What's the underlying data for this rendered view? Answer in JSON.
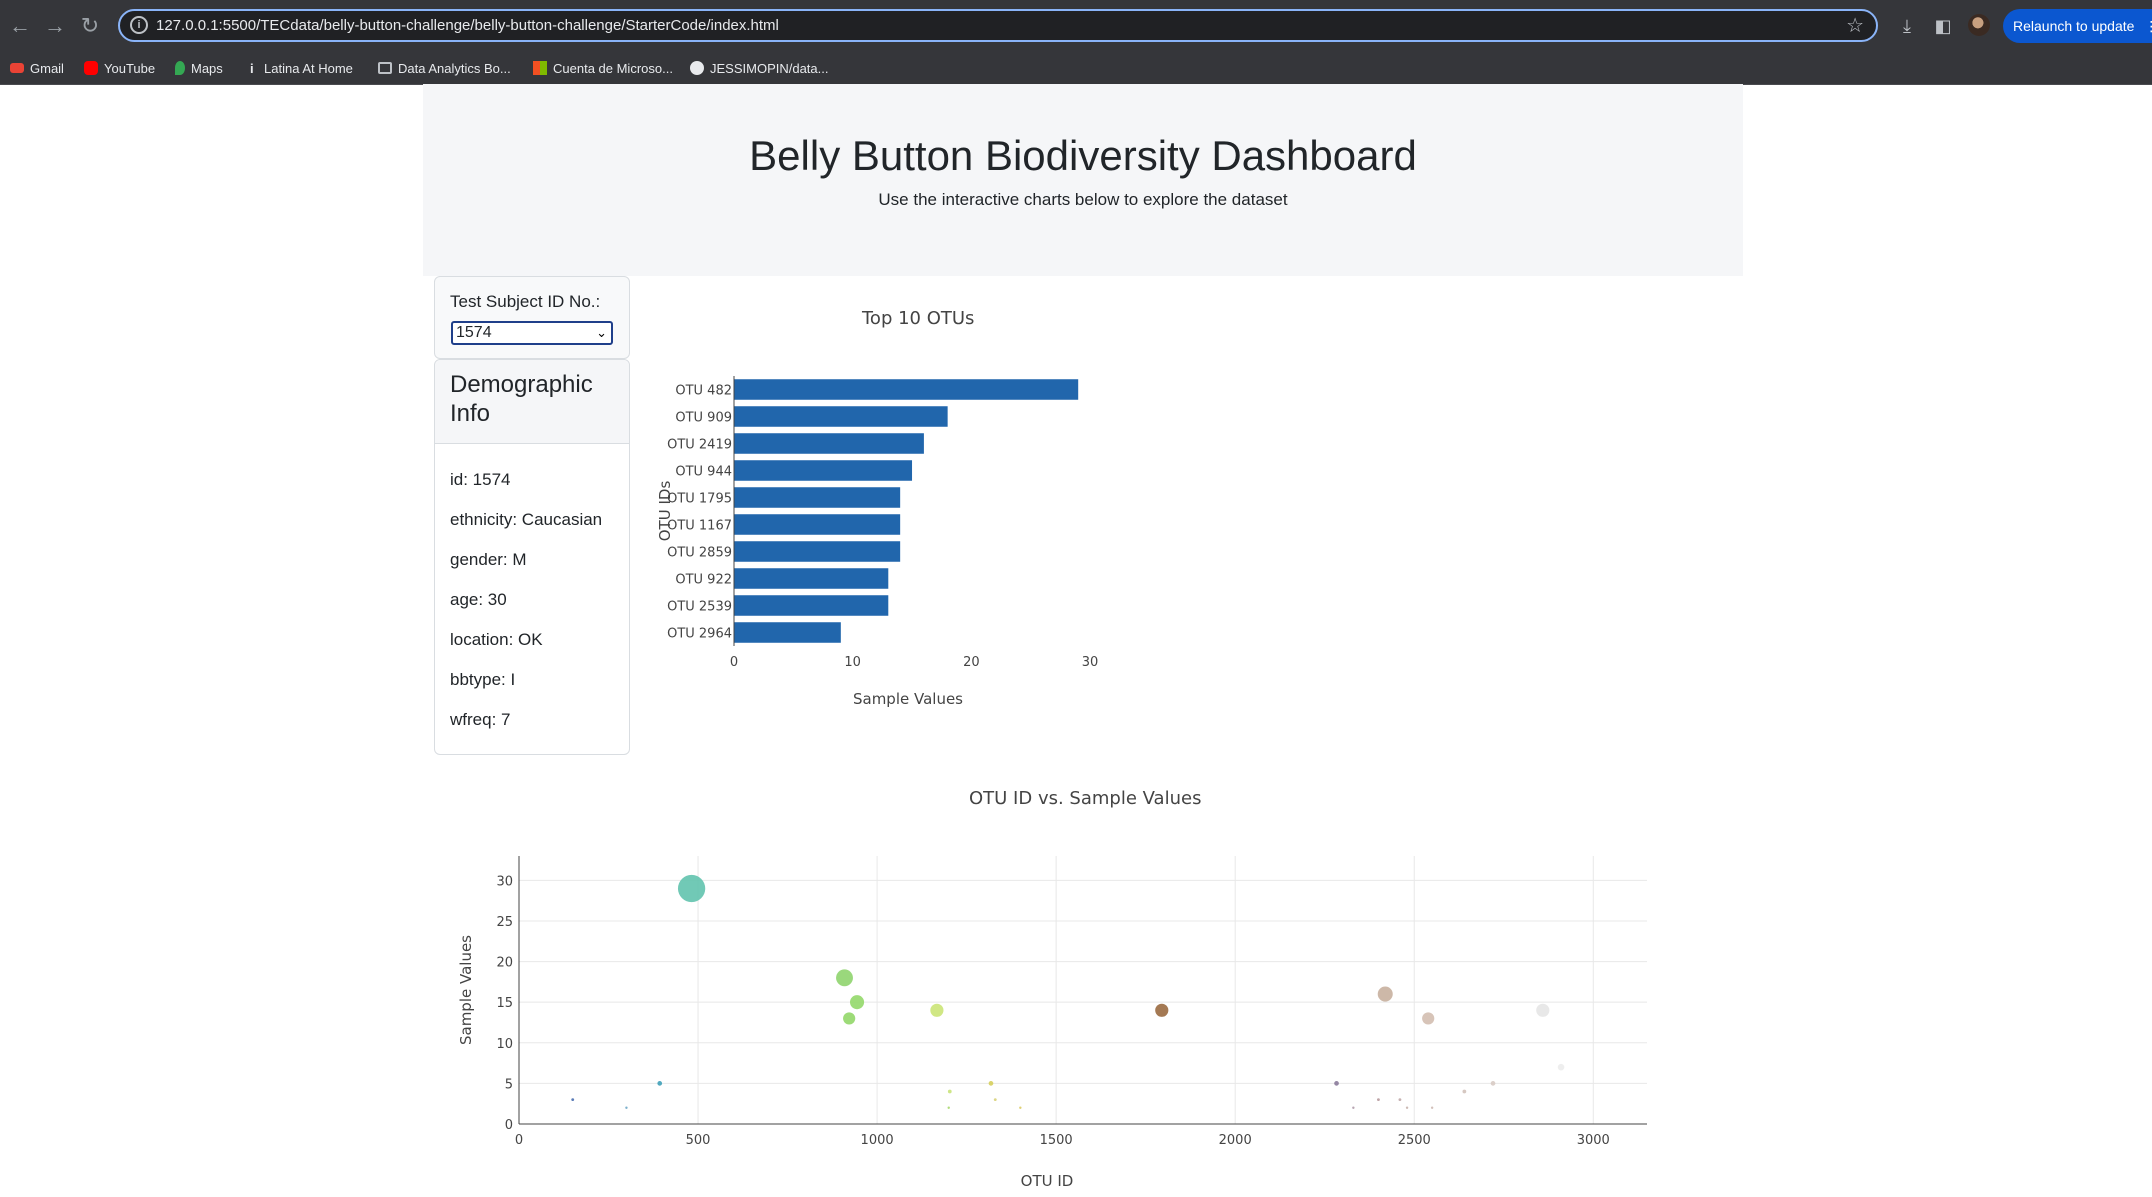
{
  "browser": {
    "url": "127.0.0.1:5500/TECdata/belly-button-challenge/belly-button-challenge/StarterCode/index.html",
    "relaunch_label": "Relaunch to update",
    "bookmarks": [
      {
        "label": "Gmail",
        "icon": "gmail-icon",
        "color": "#ea4335"
      },
      {
        "label": "YouTube",
        "icon": "youtube-icon",
        "color": "#ff0000"
      },
      {
        "label": "Maps",
        "icon": "maps-icon",
        "color": "#34a853"
      },
      {
        "label": "Latina At Home",
        "icon": "info-icon",
        "color": "#e8eaed"
      },
      {
        "label": "Data Analytics Bo...",
        "icon": "folder-icon",
        "color": "#bdc1c6"
      },
      {
        "label": "Cuenta de Microso...",
        "icon": "microsoft-icon",
        "color": "#f25022"
      },
      {
        "label": "JESSIMOPIN/data...",
        "icon": "github-icon",
        "color": "#e8eaed"
      }
    ]
  },
  "page": {
    "title": "Belly Button Biodiversity Dashboard",
    "subtitle": "Use the interactive charts below to explore the dataset"
  },
  "selector": {
    "label": "Test Subject ID No.:",
    "selected": "1574"
  },
  "demographics": {
    "title": "Demographic Info",
    "items": [
      "id: 1574",
      "ethnicity: Caucasian",
      "gender: M",
      "age: 30",
      "location: OK",
      "bbtype: I",
      "wfreq: 7"
    ]
  },
  "chart_data": [
    {
      "type": "bar",
      "orientation": "horizontal",
      "title": "Top 10 OTUs",
      "xlabel": "Sample Values",
      "ylabel": "OTU IDs",
      "categories": [
        "OTU 482",
        "OTU 909",
        "OTU 2419",
        "OTU 944",
        "OTU 1795",
        "OTU 1167",
        "OTU 2859",
        "OTU 922",
        "OTU 2539",
        "OTU 2964"
      ],
      "values": [
        29,
        18,
        16,
        15,
        14,
        14,
        14,
        13,
        13,
        9
      ],
      "xticks": [
        0,
        10,
        20,
        30
      ],
      "xlim": [
        0,
        30.5
      ],
      "color": "#2166ac",
      "grid": false
    },
    {
      "type": "scatter",
      "title": "OTU ID vs. Sample Values",
      "xlabel": "OTU ID",
      "ylabel": "Sample Values",
      "xlim": [
        0,
        3150
      ],
      "ylim": [
        0,
        33
      ],
      "xticks": [
        0,
        500,
        1000,
        1500,
        2000,
        2500,
        3000
      ],
      "yticks": [
        0,
        5,
        10,
        15,
        20,
        25,
        30
      ],
      "grid": true,
      "points": [
        {
          "x": 482,
          "y": 29,
          "color": "#62c3ae"
        },
        {
          "x": 909,
          "y": 18,
          "color": "#8fd46e"
        },
        {
          "x": 944,
          "y": 15,
          "color": "#93d86a"
        },
        {
          "x": 922,
          "y": 13,
          "color": "#92d769"
        },
        {
          "x": 1167,
          "y": 14,
          "color": "#cbe477"
        },
        {
          "x": 1795,
          "y": 14,
          "color": "#9a6a40"
        },
        {
          "x": 2419,
          "y": 16,
          "color": "#c8b09e"
        },
        {
          "x": 2539,
          "y": 13,
          "color": "#d3beb0"
        },
        {
          "x": 2859,
          "y": 14,
          "color": "#e6e6e6"
        },
        {
          "x": 150,
          "y": 3,
          "color": "#4a6fb0"
        },
        {
          "x": 300,
          "y": 2,
          "color": "#6fa8c8"
        },
        {
          "x": 393,
          "y": 5,
          "color": "#3fa0b8"
        },
        {
          "x": 1200,
          "y": 2,
          "color": "#a9d86e"
        },
        {
          "x": 1203,
          "y": 4,
          "color": "#c9e37a"
        },
        {
          "x": 1318,
          "y": 5,
          "color": "#d6cf5c"
        },
        {
          "x": 1330,
          "y": 3,
          "color": "#d8d27a"
        },
        {
          "x": 1400,
          "y": 2,
          "color": "#dccb66"
        },
        {
          "x": 2283,
          "y": 5,
          "color": "#8a7a9a"
        },
        {
          "x": 2330,
          "y": 2,
          "color": "#b09cab"
        },
        {
          "x": 2400,
          "y": 3,
          "color": "#b89b9f"
        },
        {
          "x": 2460,
          "y": 3,
          "color": "#c0a9a8"
        },
        {
          "x": 2480,
          "y": 2,
          "color": "#c7b3ad"
        },
        {
          "x": 2550,
          "y": 2,
          "color": "#cdb9b2"
        },
        {
          "x": 2640,
          "y": 4,
          "color": "#d1c2ba"
        },
        {
          "x": 2720,
          "y": 5,
          "color": "#d8cbc4"
        },
        {
          "x": 2910,
          "y": 7,
          "color": "#ececec"
        }
      ]
    }
  ]
}
